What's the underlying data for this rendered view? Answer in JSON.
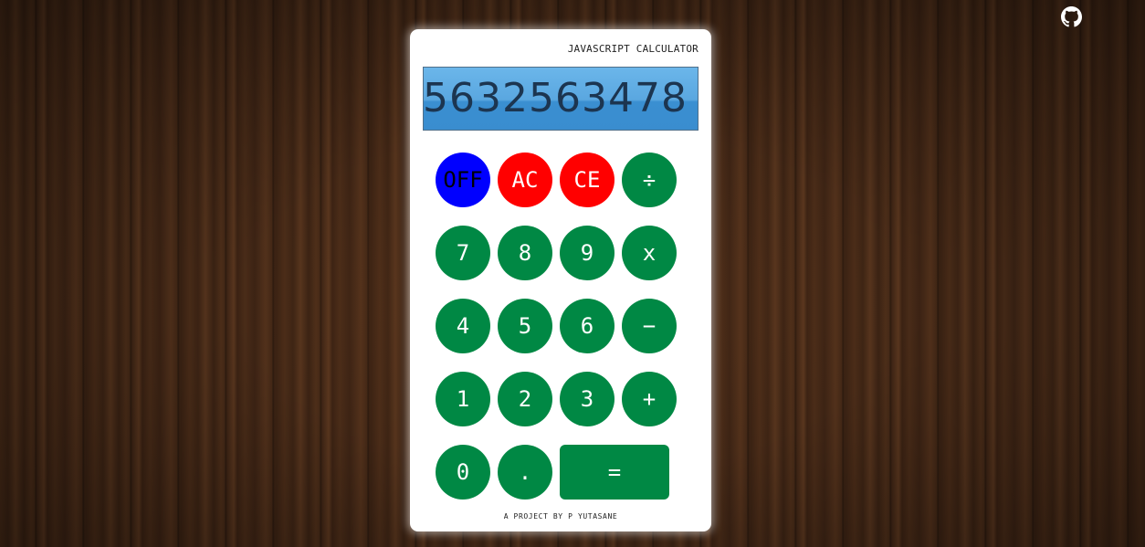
{
  "header": {
    "github_icon": "github-icon"
  },
  "calculator": {
    "title": "JAVASCRIPT CALCULATOR",
    "display": "5632563478",
    "credit": "A PROJECT BY P YUTASANE",
    "keys": {
      "off": "OFF",
      "ac": "AC",
      "ce": "CE",
      "divide": "÷",
      "seven": "7",
      "eight": "8",
      "nine": "9",
      "multiply": "x",
      "four": "4",
      "five": "5",
      "six": "6",
      "subtract": "−",
      "one": "1",
      "two": "2",
      "three": "3",
      "add": "+",
      "zero": "0",
      "decimal": ".",
      "equals": "="
    }
  },
  "colors": {
    "digit_key": "#008844",
    "off_key": "#0000ff",
    "clear_key": "#ff0000",
    "screen": "#5aa7e0"
  }
}
